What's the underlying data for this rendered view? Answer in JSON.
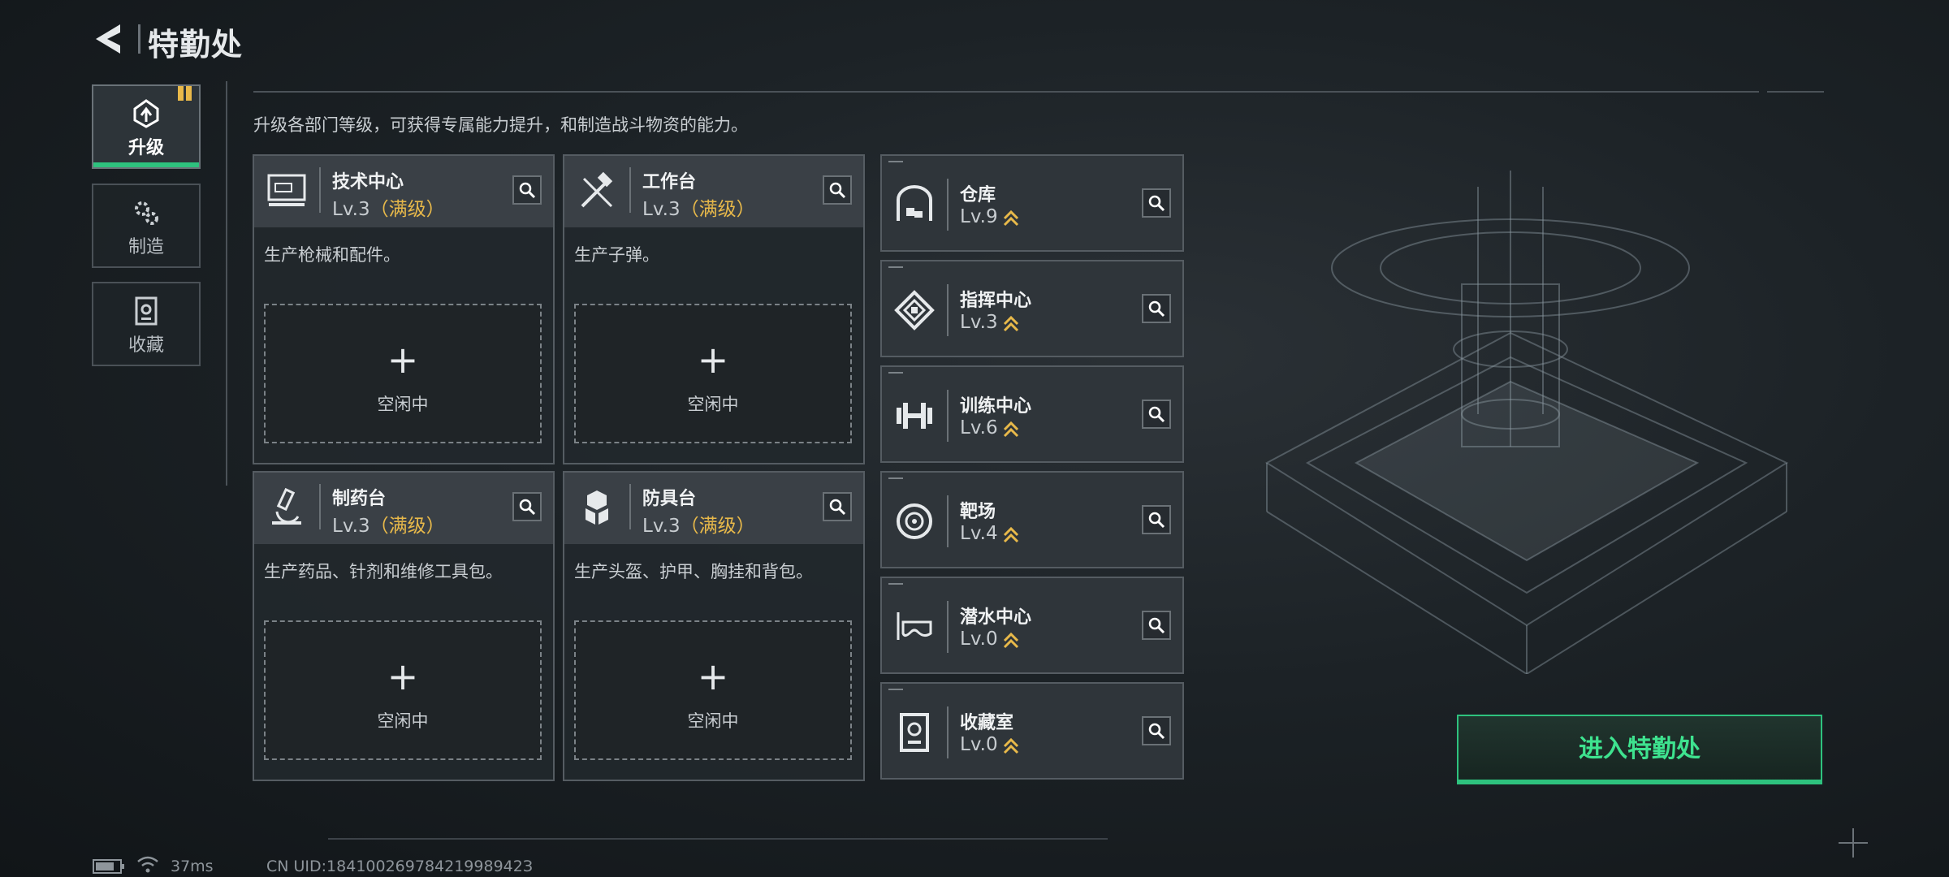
{
  "header": {
    "title": "特勤处",
    "back_icon": "back-arrow-icon"
  },
  "nav": [
    {
      "label": "升级",
      "icon": "upgrade-icon",
      "active": true
    },
    {
      "label": "制造",
      "icon": "gears-icon",
      "active": false
    },
    {
      "label": "收藏",
      "icon": "collection-icon",
      "active": false
    }
  ],
  "description": "升级各部门等级，可获得专属能力提升，和制造战斗物资的能力。",
  "production": [
    {
      "name": "技术中心",
      "level": "Lv.3",
      "max": "（满级）",
      "desc": "生产枪械和配件。",
      "slot_plus": "+",
      "slot_status": "空闲中",
      "icon": "computer-icon"
    },
    {
      "name": "工作台",
      "level": "Lv.3",
      "max": "（满级）",
      "desc": "生产子弹。",
      "slot_plus": "+",
      "slot_status": "空闲中",
      "icon": "tools-icon"
    },
    {
      "name": "制药台",
      "level": "Lv.3",
      "max": "（满级）",
      "desc": "生产药品、针剂和维修工具包。",
      "slot_plus": "+",
      "slot_status": "空闲中",
      "icon": "microscope-icon"
    },
    {
      "name": "防具台",
      "level": "Lv.3",
      "max": "（满级）",
      "desc": "生产头盔、护甲、胸挂和背包。",
      "slot_plus": "+",
      "slot_status": "空闲中",
      "icon": "armor-icon"
    }
  ],
  "facilities": [
    {
      "name": "仓库",
      "level": "Lv.9",
      "icon": "warehouse-icon"
    },
    {
      "name": "指挥中心",
      "level": "Lv.3",
      "icon": "command-icon"
    },
    {
      "name": "训练中心",
      "level": "Lv.6",
      "icon": "dumbbell-icon"
    },
    {
      "name": "靶场",
      "level": "Lv.4",
      "icon": "target-icon"
    },
    {
      "name": "潜水中心",
      "level": "Lv.0",
      "icon": "diving-mask-icon"
    },
    {
      "name": "收藏室",
      "level": "Lv.0",
      "icon": "collection-room-icon"
    }
  ],
  "enter_button": "进入特勤处",
  "status": {
    "ping": "37ms",
    "uid": "CN UID:18410026978421998942З"
  },
  "colors": {
    "accent_green": "#2ec27e",
    "max_gold": "#e8b94a",
    "badge": "#e9b94a"
  }
}
